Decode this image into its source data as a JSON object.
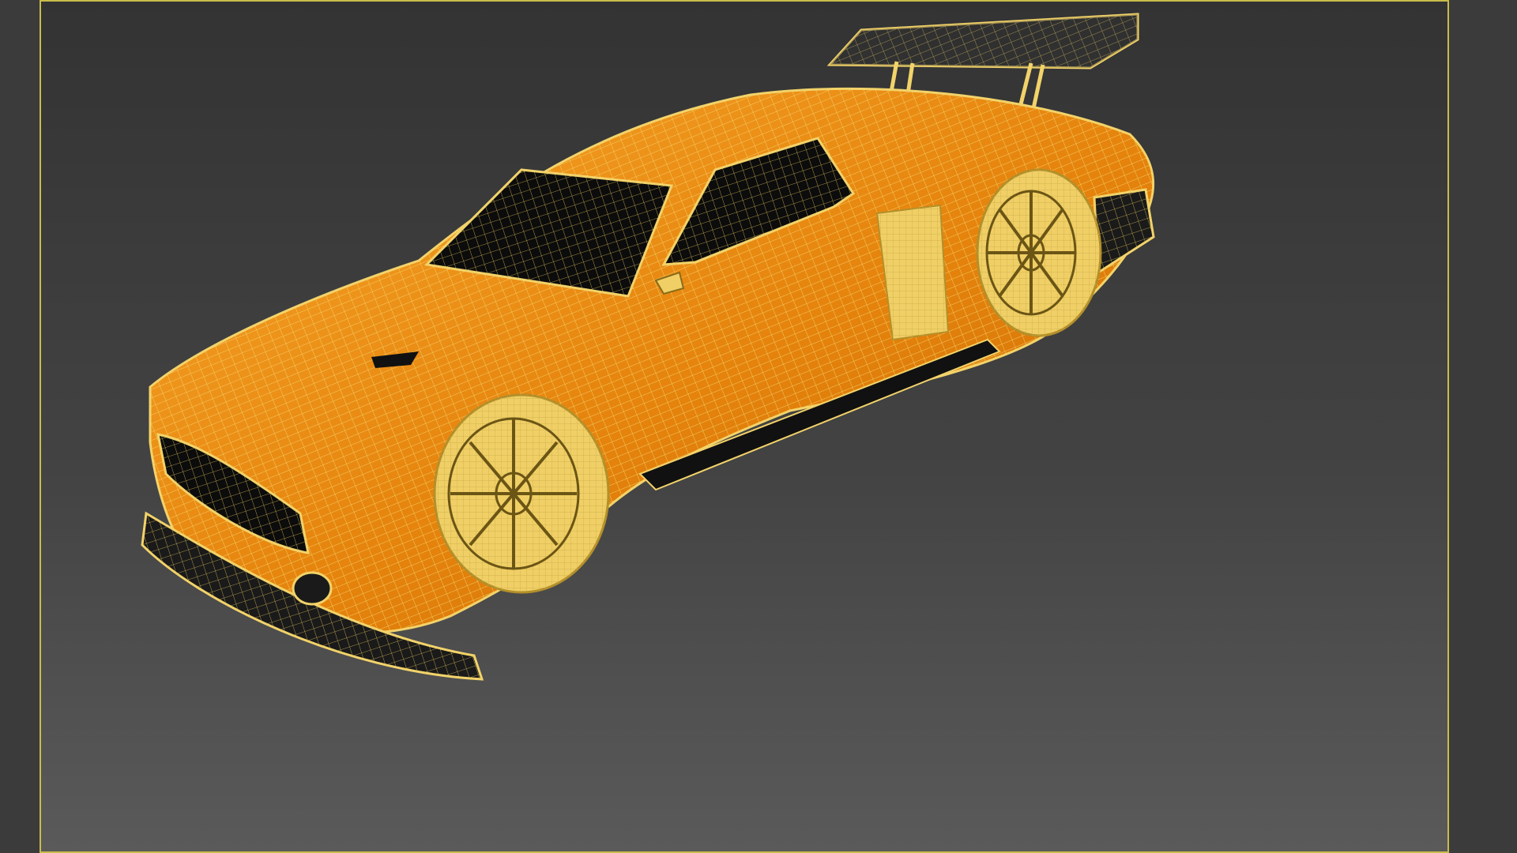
{
  "viewport": {
    "active_border_color": "#c8bd4a",
    "background_top": "#333333",
    "background_bottom": "#5a5a5a"
  },
  "model": {
    "display_mode": "wireframe-over-shaded",
    "wire_color": "#f2d36a",
    "body_color": "#e8860c",
    "body_highlight": "#f6a321",
    "glass_color": "#0c0c0c"
  }
}
